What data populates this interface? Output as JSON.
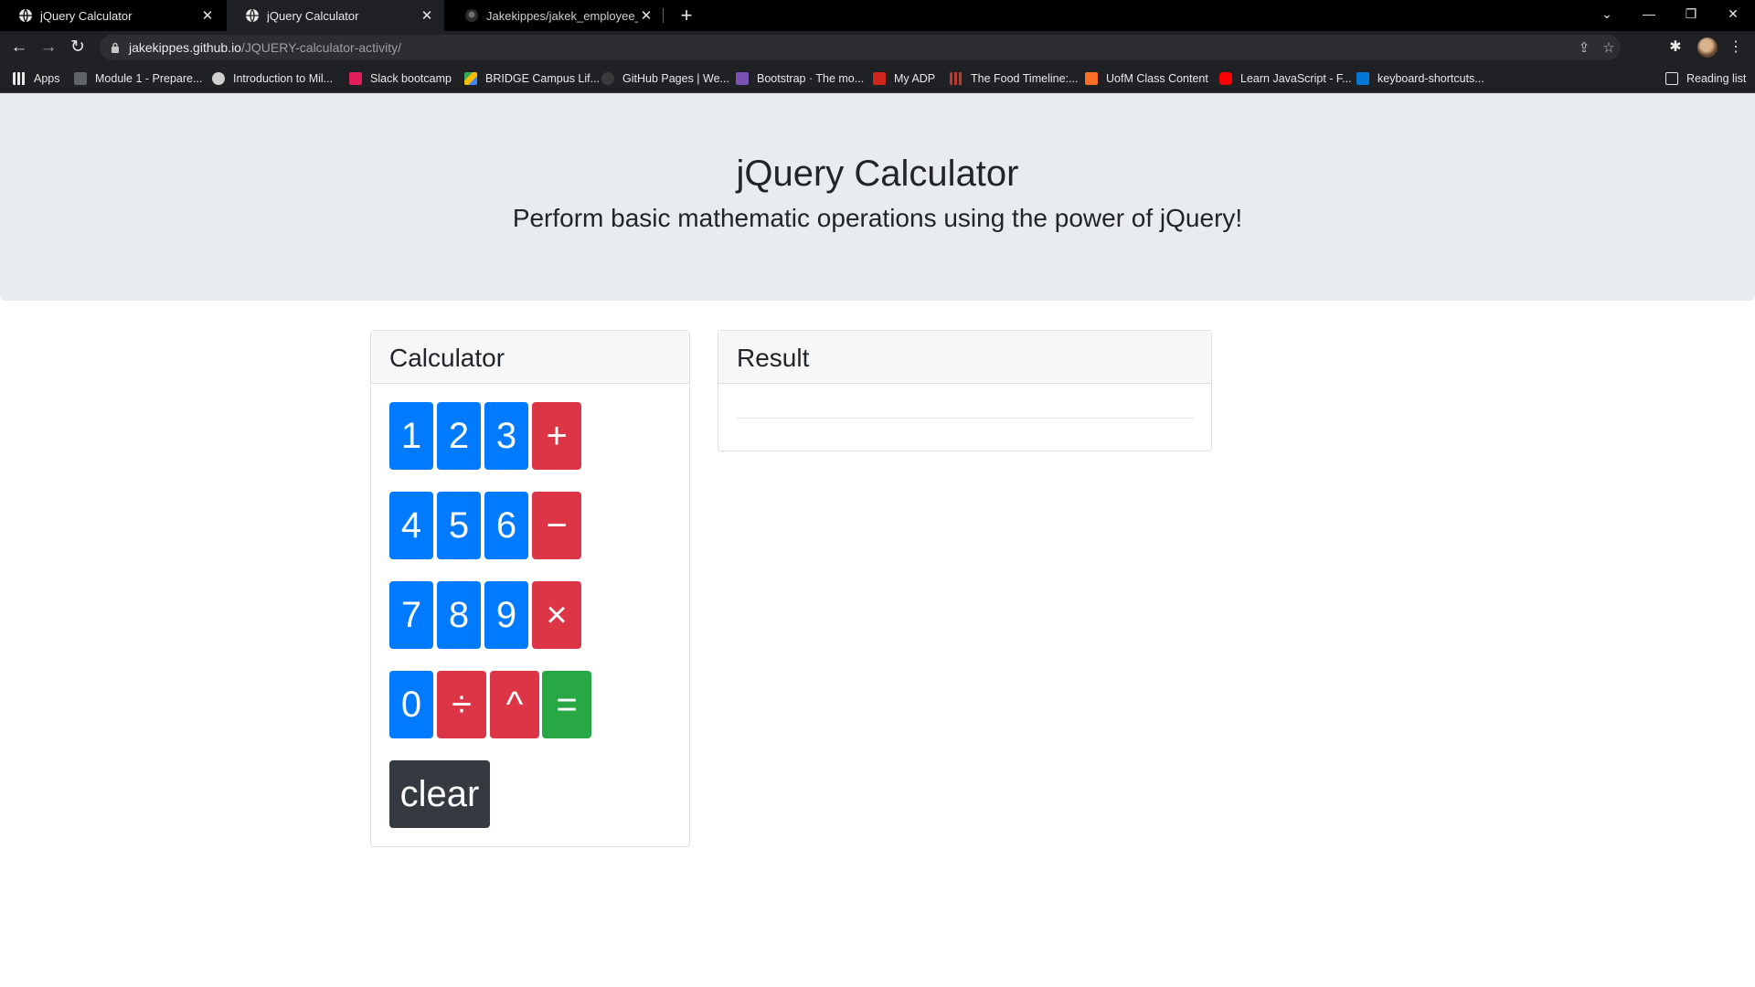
{
  "browser": {
    "tabs": [
      {
        "title": "jQuery Calculator",
        "active": false,
        "favicon": "globe-icon"
      },
      {
        "title": "jQuery Calculator",
        "active": true,
        "favicon": "globe-icon"
      },
      {
        "title": "Jakekippes/jakek_employee_dire",
        "active": false,
        "favicon": "github-icon"
      }
    ],
    "url_host": "jakekippes.github.io",
    "url_path": "/JQUERY-calculator-activity/",
    "bookmarks": [
      {
        "label": "Apps",
        "icon": "apps-grid-icon",
        "color": "#e8e8e8"
      },
      {
        "label": "Module 1 - Prepare...",
        "icon": "book-icon",
        "color": "#1a1a1a"
      },
      {
        "label": "Introduction to Mil...",
        "icon": "circle-logo-icon",
        "color": "#d0d0d0"
      },
      {
        "label": "Slack bootcamp",
        "icon": "slack-icon",
        "color": "#e01e5a"
      },
      {
        "label": "BRIDGE Campus Lif...",
        "icon": "drive-icon",
        "color": "#fbbc04"
      },
      {
        "label": "GitHub Pages | We...",
        "icon": "github-icon",
        "color": "#e8e8e8"
      },
      {
        "label": "Bootstrap · The mo...",
        "icon": "bootstrap-icon",
        "color": "#7952b3"
      },
      {
        "label": "My ADP",
        "icon": "adp-icon",
        "color": "#d0271d"
      },
      {
        "label": "The Food Timeline:...",
        "icon": "food-timeline-icon",
        "color": "#c0392b"
      },
      {
        "label": "UofM Class Content",
        "icon": "gitlab-icon",
        "color": "#fc6d26"
      },
      {
        "label": "Learn JavaScript - F...",
        "icon": "youtube-icon",
        "color": "#ff0000"
      },
      {
        "label": "keyboard-shortcuts...",
        "icon": "vscode-icon",
        "color": "#0078d4"
      }
    ],
    "reading_list": "Reading list"
  },
  "header": {
    "title": "jQuery Calculator",
    "subtitle": "Perform basic mathematic operations using the power of jQuery!"
  },
  "calculator": {
    "title": "Calculator",
    "buttons": {
      "one": "1",
      "two": "2",
      "three": "3",
      "plus": "+",
      "four": "4",
      "five": "5",
      "six": "6",
      "minus": "−",
      "seven": "7",
      "eight": "8",
      "nine": "9",
      "multiply": "×",
      "zero": "0",
      "divide": "÷",
      "power": "^",
      "equals": "=",
      "clear": "clear"
    }
  },
  "result": {
    "title": "Result",
    "value": ""
  },
  "colors": {
    "number": "#007bff",
    "operator": "#dc3545",
    "equals": "#28a745",
    "clear": "#343a40"
  }
}
